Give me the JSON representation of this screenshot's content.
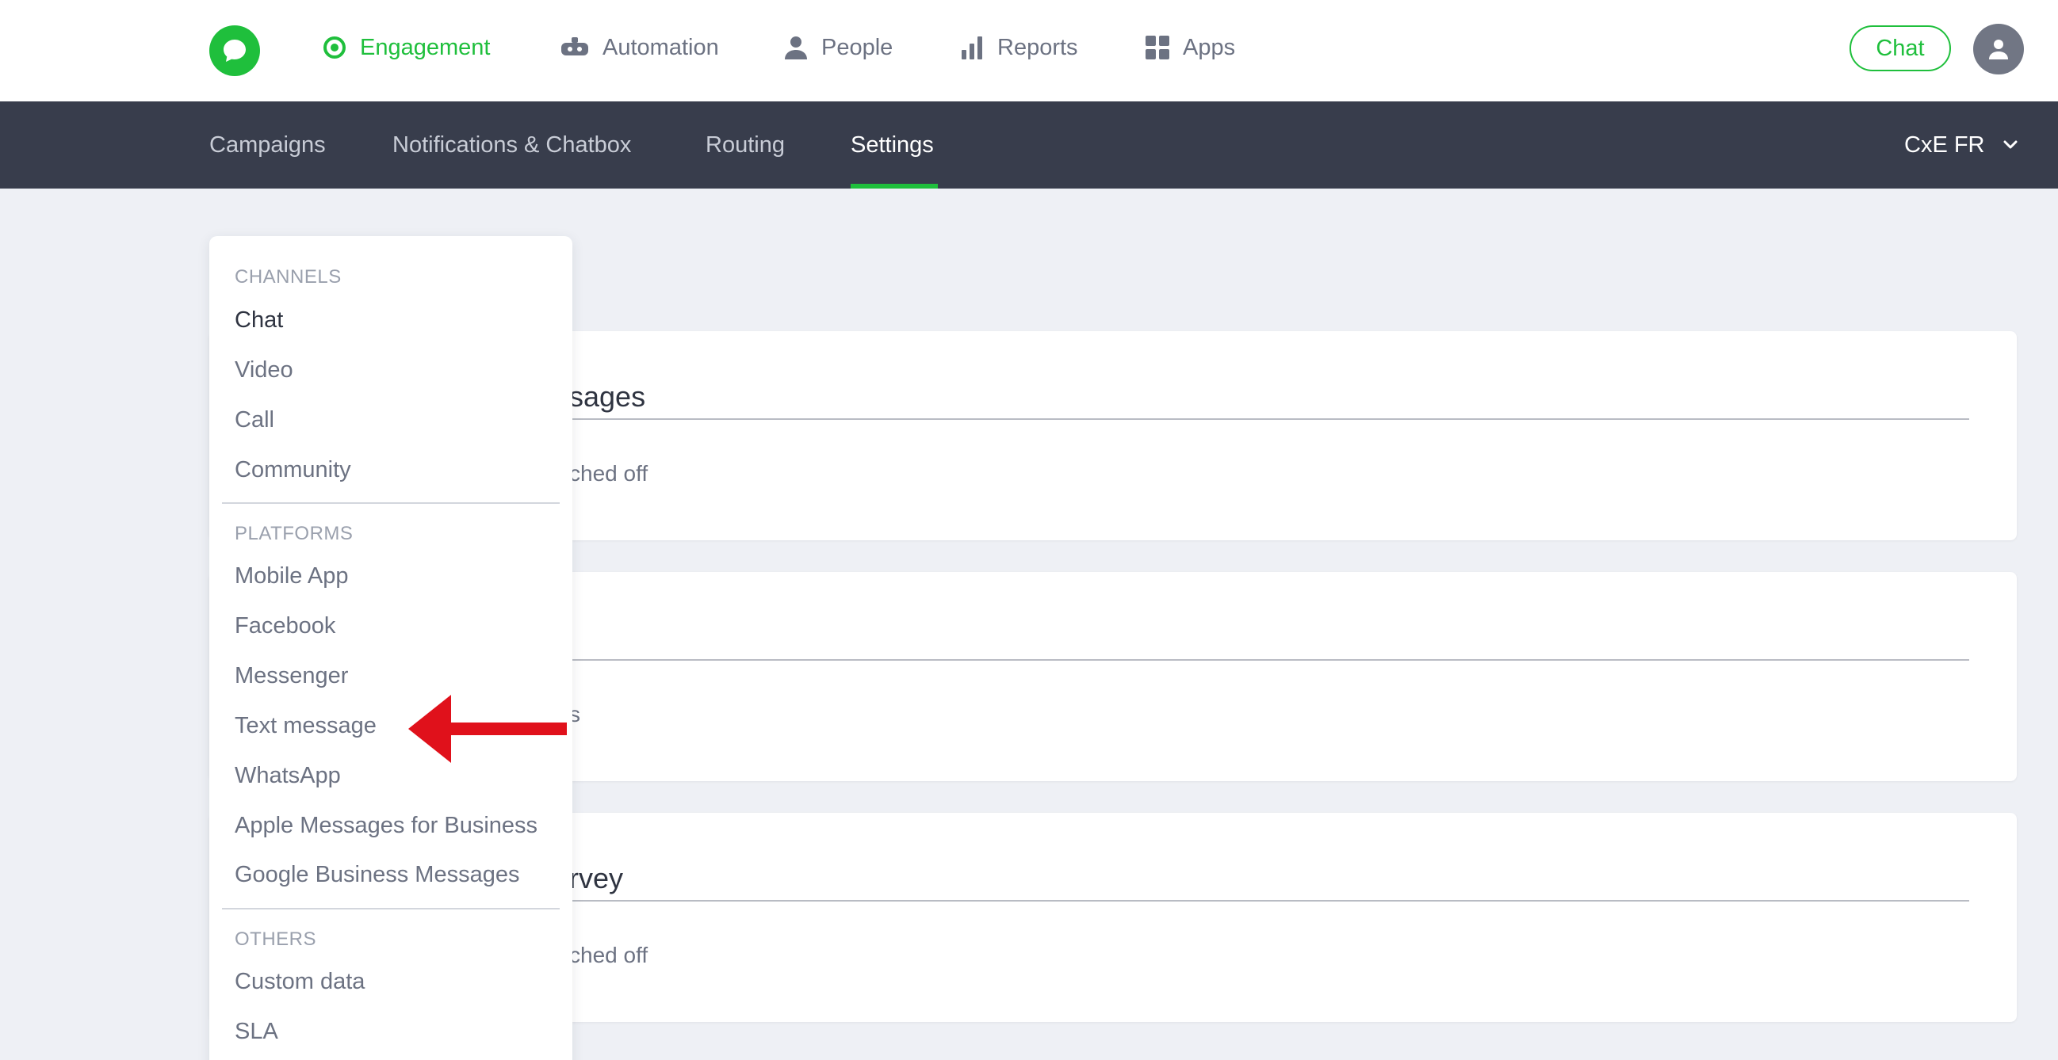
{
  "nav": {
    "items": [
      {
        "label": "Engagement",
        "icon": "target-icon",
        "active": true
      },
      {
        "label": "Automation",
        "icon": "bot-icon",
        "active": false
      },
      {
        "label": "People",
        "icon": "person-icon",
        "active": false
      },
      {
        "label": "Reports",
        "icon": "bar-chart-icon",
        "active": false
      },
      {
        "label": "Apps",
        "icon": "grid-icon",
        "active": false
      }
    ],
    "chat_button": "Chat"
  },
  "subnav": {
    "items": [
      {
        "label": "Campaigns"
      },
      {
        "label": "Notifications & Chatbox"
      },
      {
        "label": "Routing"
      },
      {
        "label": "Settings",
        "active": true
      }
    ],
    "workspace": "CxE FR"
  },
  "cards": [
    {
      "title": "sages",
      "text": "ched off"
    },
    {
      "title": "",
      "text": "s"
    },
    {
      "title": "rvey",
      "text": "ched off"
    }
  ],
  "menu": {
    "sections": [
      {
        "title": "CHANNELS",
        "items": [
          "Chat",
          "Video",
          "Call",
          "Community"
        ]
      },
      {
        "title": "PLATFORMS",
        "items": [
          "Mobile App",
          "Facebook",
          "Messenger",
          "Text message",
          "WhatsApp",
          "Apple Messages for Business",
          "Google Business Messages"
        ]
      },
      {
        "title": "OTHERS",
        "items": [
          "Custom data",
          "SLA"
        ]
      }
    ],
    "selected": "Chat"
  },
  "colors": {
    "brand_green": "#1fbf3c",
    "subnav_bg": "#383d4c",
    "page_bg": "#eef0f5",
    "annotation_arrow": "#e0111b"
  }
}
